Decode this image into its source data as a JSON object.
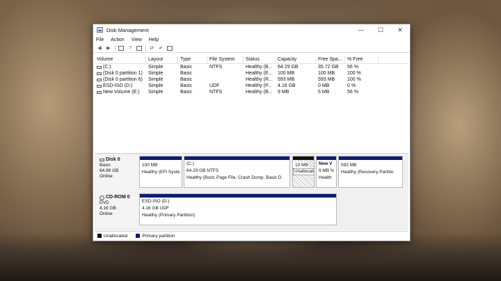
{
  "window": {
    "title": "Disk Management",
    "controls": [
      "—",
      "☐",
      "✕"
    ]
  },
  "menu": [
    "File",
    "Action",
    "View",
    "Help"
  ],
  "columns": [
    "Volume",
    "Layout",
    "Type",
    "File System",
    "Status",
    "Capacity",
    "Free Spa...",
    "% Free"
  ],
  "volumes": [
    [
      "(C:)",
      "Simple",
      "Basic",
      "NTFS",
      "Healthy (B...",
      "64.29 GB",
      "35.72 GB",
      "56 %"
    ],
    [
      "(Disk 0 partition 1)",
      "Simple",
      "Basic",
      "",
      "Healthy (E...",
      "100 MB",
      "100 MB",
      "100 %"
    ],
    [
      "(Disk 0 partition 6)",
      "Simple",
      "Basic",
      "",
      "Healthy (R...",
      "593 MB",
      "593 MB",
      "100 %"
    ],
    [
      "ESD-ISO (D:)",
      "Simple",
      "Basic",
      "UDF",
      "Healthy (P...",
      "4.16 GB",
      "0 MB",
      "0 %"
    ],
    [
      "New Volume (E:)",
      "Simple",
      "Basic",
      "NTFS",
      "Healthy (B...",
      "9 MB",
      "5 MB",
      "56 %"
    ]
  ],
  "disks": [
    {
      "name": "Disk 0",
      "type": "Basic",
      "size": "64.98 GB",
      "state": "Online",
      "partitions": [
        {
          "title": "",
          "size": "100 MB",
          "status": "Healthy (EFI Syste"
        },
        {
          "title": "(C:)",
          "size": "64.29 GB NTFS",
          "status": "Healthy (Boot, Page File, Crash Dump, Basic D"
        },
        {
          "title": "",
          "size": "10 MB",
          "status": "Unallocated"
        },
        {
          "title": "New V",
          "size": "9 MB N",
          "status": "Health"
        },
        {
          "title": "",
          "size": "593 MB",
          "status": "Healthy (Recovery Partitio"
        }
      ]
    },
    {
      "name": "CD-ROM 0",
      "type": "DVD",
      "size": "4.16 GB",
      "state": "Online",
      "partitions": [
        {
          "title": "ESD-ISO  (D:)",
          "size": "4.16 GB UDF",
          "status": "Healthy (Primary Partition)"
        }
      ]
    }
  ],
  "legend": [
    "Unallocated",
    "Primary partition"
  ],
  "colors": {
    "unallocated": "#111111",
    "primary": "#0a1e78"
  }
}
